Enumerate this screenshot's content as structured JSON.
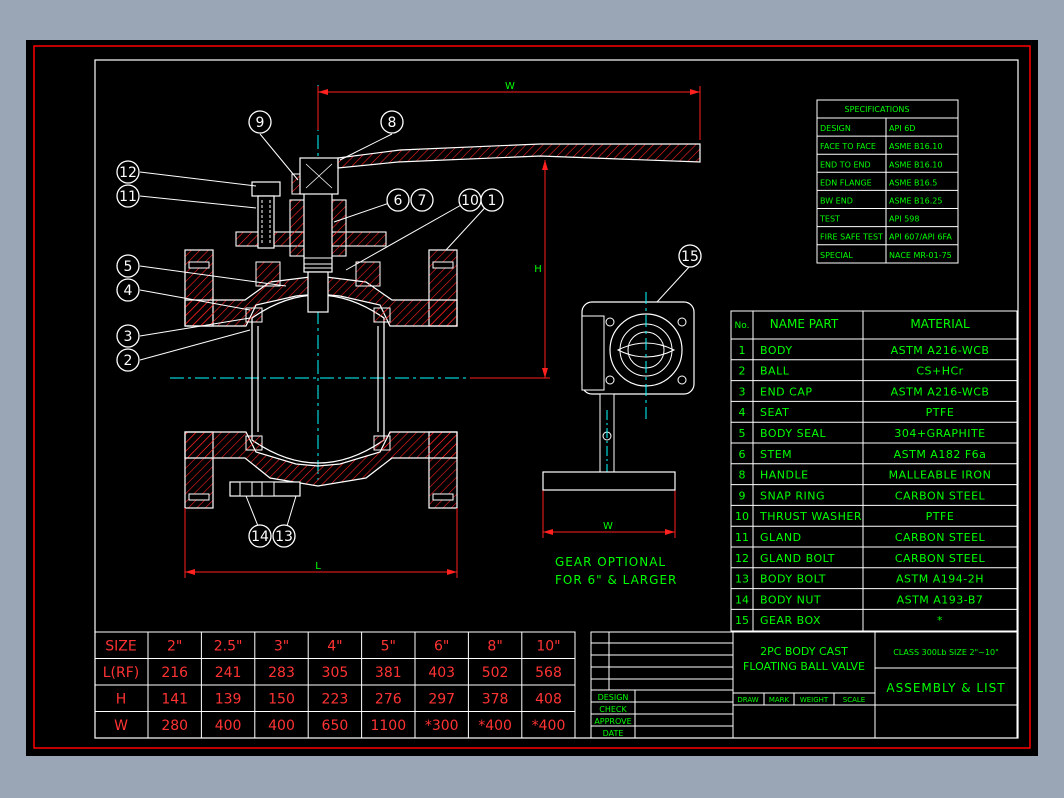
{
  "dimension_labels": {
    "w_top": "W",
    "h_side": "H",
    "l_bottom": "L",
    "w_gear": "W"
  },
  "balloons": [
    "9",
    "8",
    "12",
    "11",
    "6",
    "7",
    "10",
    "1",
    "5",
    "4",
    "3",
    "2",
    "14",
    "13",
    "15"
  ],
  "gear_note": [
    "GEAR OPTIONAL",
    "FOR 6\" & LARGER"
  ],
  "specifications": {
    "title": "SPECIFICATIONS",
    "rows": [
      [
        "DESIGN",
        "API 6D"
      ],
      [
        "FACE TO FACE",
        "ASME B16.10"
      ],
      [
        "END TO END",
        "ASME B16.10"
      ],
      [
        "EDN FLANGE",
        "ASME B16.5"
      ],
      [
        "BW END",
        "ASME B16.25"
      ],
      [
        "TEST",
        "API 598"
      ],
      [
        "FIRE SAFE TEST",
        "API 607/API 6FA"
      ],
      [
        "SPECIAL",
        "NACE MR-01-75"
      ]
    ]
  },
  "parts": {
    "headers": [
      "No.",
      "NAME PART",
      "MATERIAL"
    ],
    "rows": [
      [
        "1",
        "BODY",
        "ASTM A216-WCB"
      ],
      [
        "2",
        "BALL",
        "CS+HCr"
      ],
      [
        "3",
        "END CAP",
        "ASTM A216-WCB"
      ],
      [
        "4",
        "SEAT",
        "PTFE"
      ],
      [
        "5",
        "BODY SEAL",
        "304+GRAPHITE"
      ],
      [
        "6",
        "STEM",
        "ASTM A182 F6a"
      ],
      [
        "8",
        "HANDLE",
        "MALLEABLE IRON"
      ],
      [
        "9",
        "SNAP RING",
        "CARBON STEEL"
      ],
      [
        "10",
        "THRUST WASHER",
        "PTFE"
      ],
      [
        "11",
        "GLAND",
        "CARBON STEEL"
      ],
      [
        "12",
        "GLAND BOLT",
        "CARBON STEEL"
      ],
      [
        "13",
        "BODY BOLT",
        "ASTM A194-2H"
      ],
      [
        "14",
        "BODY NUT",
        "ASTM A193-B7"
      ],
      [
        "15",
        "GEAR BOX",
        "*"
      ]
    ]
  },
  "sizes": {
    "row_labels": [
      "SIZE",
      "L(RF)",
      "H",
      "W"
    ],
    "size": [
      "2\"",
      "2.5\"",
      "3\"",
      "4\"",
      "5\"",
      "6\"",
      "8\"",
      "10\""
    ],
    "l_rf": [
      "216",
      "241",
      "283",
      "305",
      "381",
      "403",
      "502",
      "568"
    ],
    "h": [
      "141",
      "139",
      "150",
      "223",
      "276",
      "297",
      "378",
      "408"
    ],
    "w": [
      "280",
      "400",
      "400",
      "650",
      "1100",
      "*300",
      "*400",
      "*400"
    ]
  },
  "title_block": {
    "title_line1": "2PC BODY CAST",
    "title_line2": "FLOATING BALL VALVE",
    "class_text": "CLASS 300Lb SIZE 2\"~10\"",
    "assembly": "ASSEMBLY & LIST",
    "left_labels": [
      "DESIGN",
      "CHECK",
      "APPROVE",
      "DATE"
    ],
    "small_headers": [
      "DRAW",
      "MARK",
      "WEIGHT",
      "SCALE"
    ]
  },
  "colors": {
    "background": "#9aa5b5",
    "sheet": "#000000",
    "border": "#ff0000",
    "frame": "#ffffff",
    "text": "#00ff00",
    "table_text": "#ff3333",
    "centerline": "#00ffff",
    "outline": "#ffffff",
    "hatch": "#ff2020",
    "balloon": "#ffffff"
  }
}
